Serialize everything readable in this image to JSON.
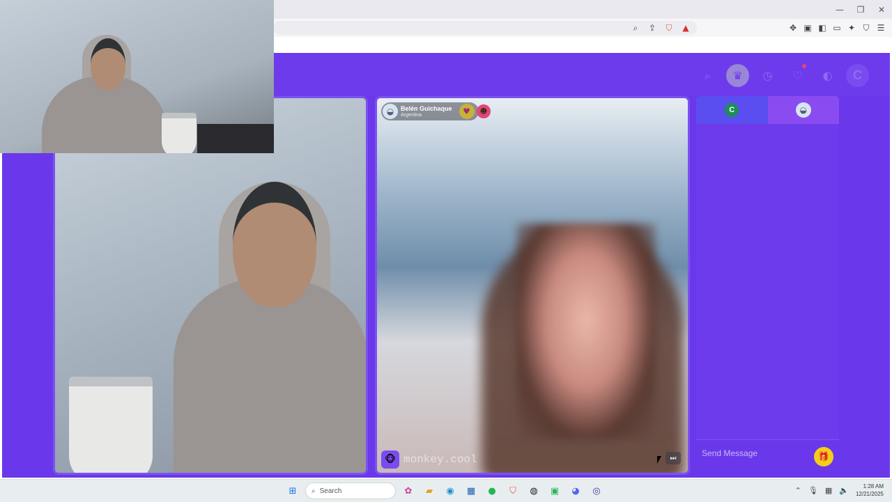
{
  "browser": {
    "window_controls": [
      "—",
      "❐",
      "✕"
    ],
    "toolbar_icons": [
      "zoom-icon",
      "share-icon",
      "brave-shield-icon",
      "brave-rewards-icon"
    ],
    "right_icons": [
      "extensions-icon",
      "tab-search-icon",
      "sidebar-icon",
      "wallet-icon",
      "leo-icon",
      "vpn-icon",
      "menu-icon"
    ]
  },
  "header": {
    "icons": [
      "search-icon",
      "crown-icon",
      "history-icon",
      "chat-icon",
      "explore-icon"
    ],
    "avatar_letter": "C"
  },
  "remote_user": {
    "name": "Belén Guichaque",
    "country": "Argentina"
  },
  "watermark": {
    "text": "monkey.cool"
  },
  "chat": {
    "tab1_letter": "C",
    "placeholder": "Send Message"
  },
  "taskbar": {
    "search_label": "Search",
    "time": "1:28 AM",
    "date": "12/21/2025"
  },
  "colors": {
    "brand": "#6a38ea",
    "gift": "#f2cf1a"
  }
}
